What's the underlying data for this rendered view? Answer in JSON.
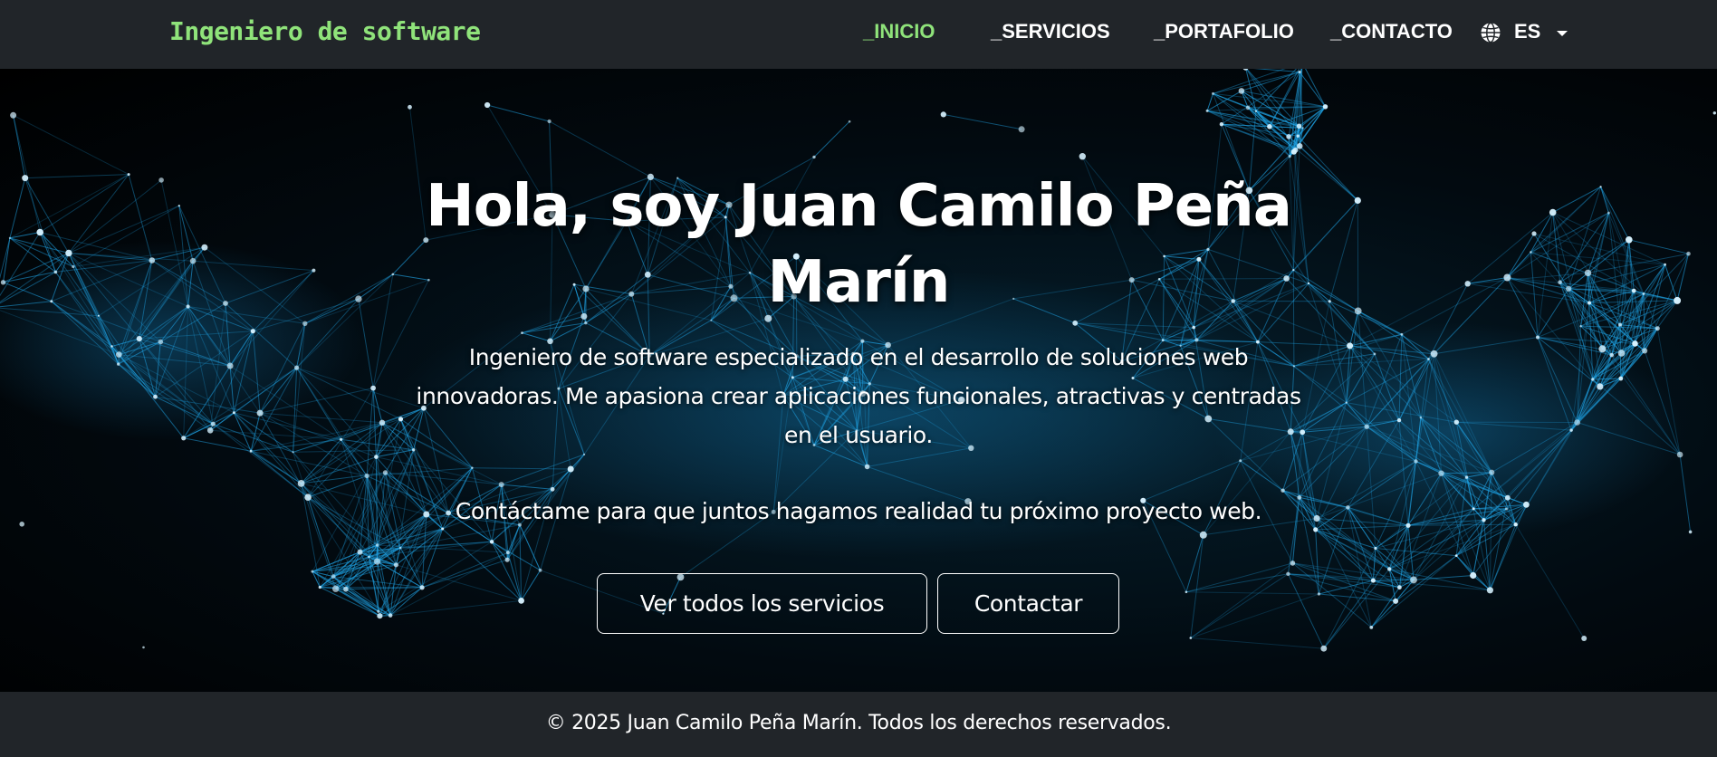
{
  "colors": {
    "accent": "#8fe37a",
    "navbar_bg": "#212529",
    "network_line": "#1fa4e6",
    "node": "#d7f2ff"
  },
  "navbar": {
    "brand": "Ingeniero de software",
    "items": [
      {
        "label": "_INICIO",
        "active": true
      },
      {
        "label": "_SERVICIOS",
        "active": false
      },
      {
        "label": "_PORTAFOLIO",
        "active": false
      },
      {
        "label": "_CONTACTO",
        "active": false
      }
    ],
    "language": {
      "icon": "globe-icon",
      "code": "ES",
      "dropdown_icon": "caret-down-icon"
    }
  },
  "hero": {
    "title": "Hola, soy Juan Camilo Peña Marín",
    "description": "Ingeniero de software especializado en el desarrollo de soluciones web innovadoras. Me apasiona crear aplicaciones funcionales, atractivas y centradas en el usuario.",
    "cta_text": "Contáctame para que juntos hagamos realidad tu próximo proyecto web.",
    "buttons": {
      "services": "Ver todos los servicios",
      "contact": "Contactar"
    }
  },
  "footer": {
    "copyright": "© 2025 Juan Camilo Peña Marín. Todos los derechos reservados."
  }
}
